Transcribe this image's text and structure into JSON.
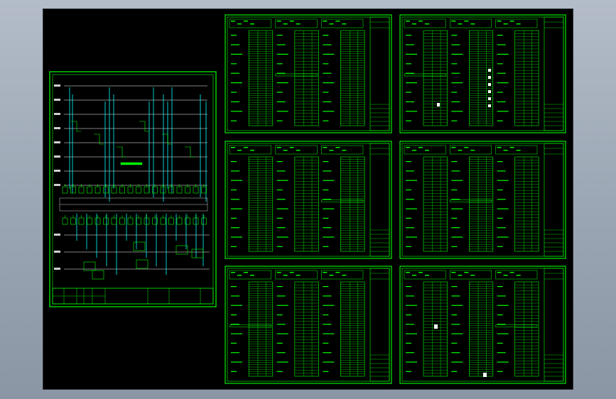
{
  "colors": {
    "background": "#000000",
    "frame": "#00ff00",
    "cyan": "#00ffff",
    "white": "#ffffff",
    "bus_label": "#d0d0d0"
  },
  "left_sheet": {
    "bus_levels": 8,
    "vertical_groups": 6
  },
  "table_sheets": {
    "rows": 3,
    "columns": 2
  }
}
